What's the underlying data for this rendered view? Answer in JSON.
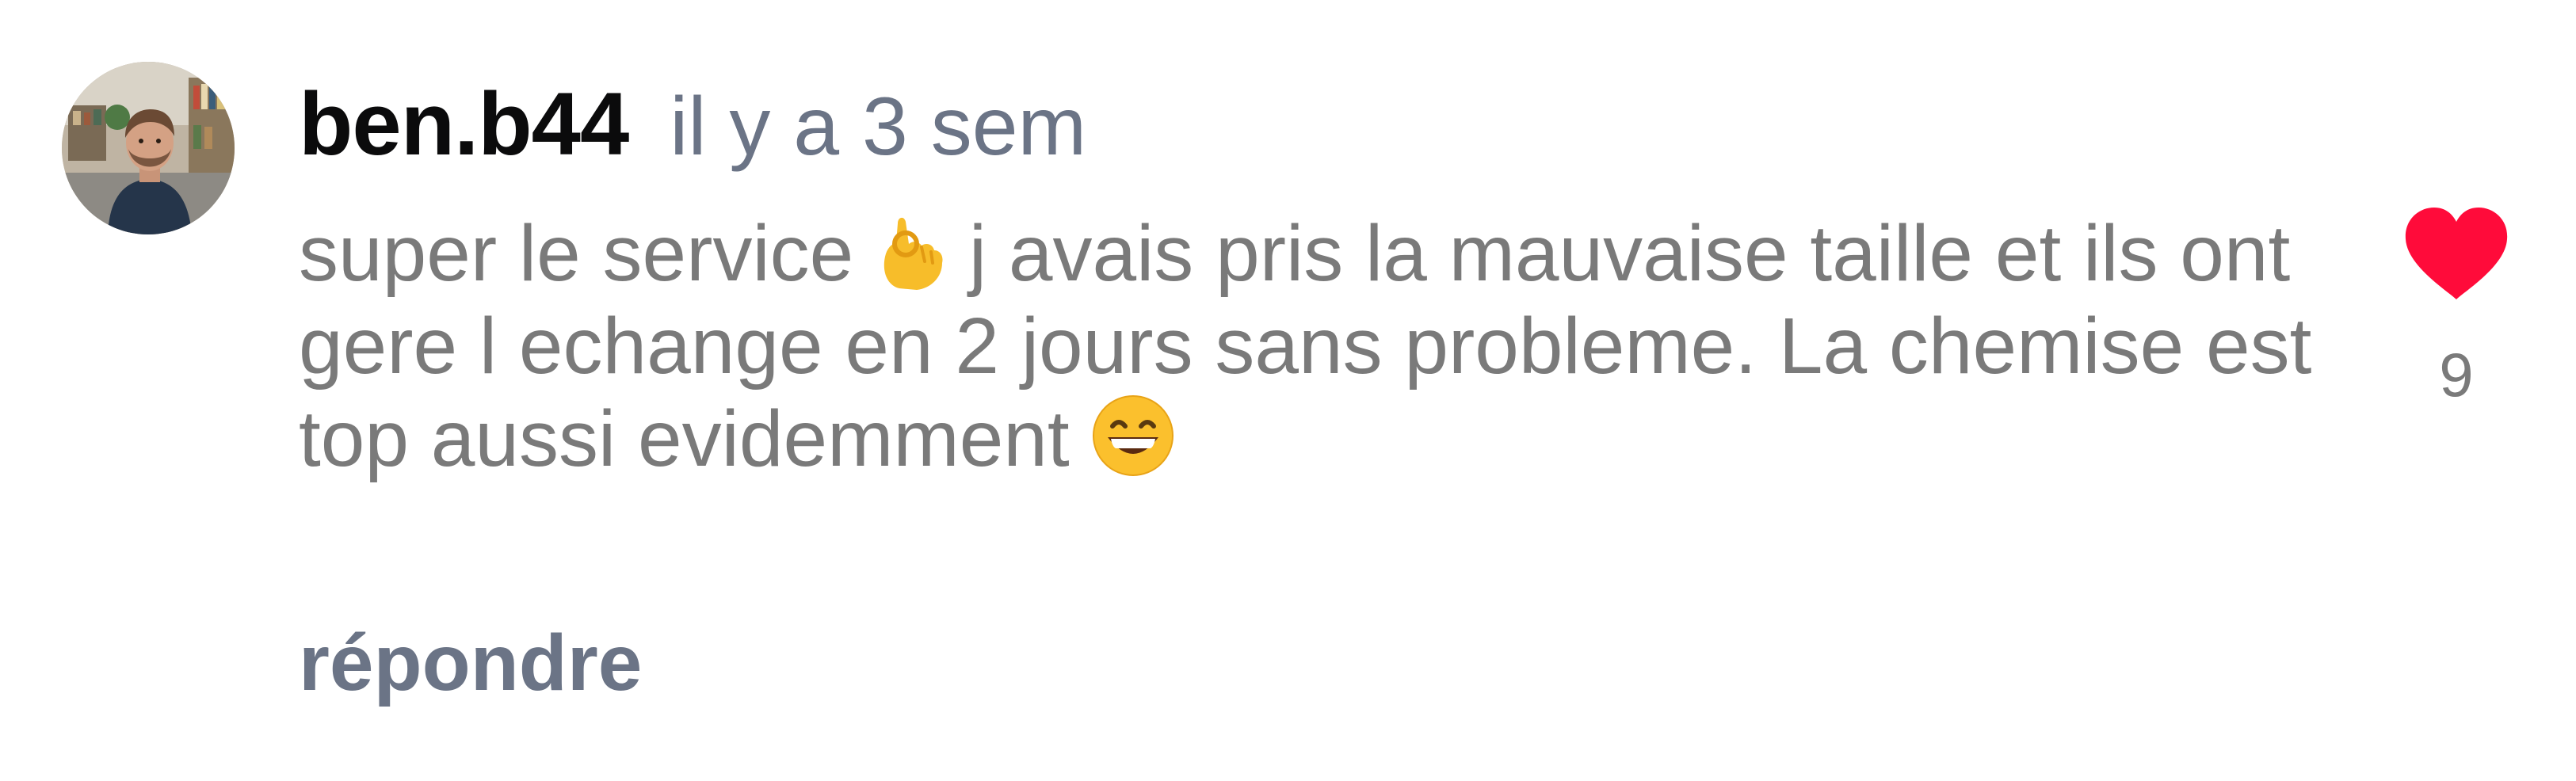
{
  "comment": {
    "username": "ben.b44",
    "time_ago": "il y a 3 sem",
    "text_parts": [
      "super le service ",
      " j avais pris la mauvaise taille et ils ont gere l echange en 2 jours sans probleme. La chemise est top aussi evidemment "
    ],
    "emojis": [
      "ok-hand-emoji",
      "grinning-face-emoji"
    ],
    "reply_label": "répondre",
    "like_count": "9",
    "like_icon": "heart-icon",
    "like_color": "#ff0b3a"
  }
}
